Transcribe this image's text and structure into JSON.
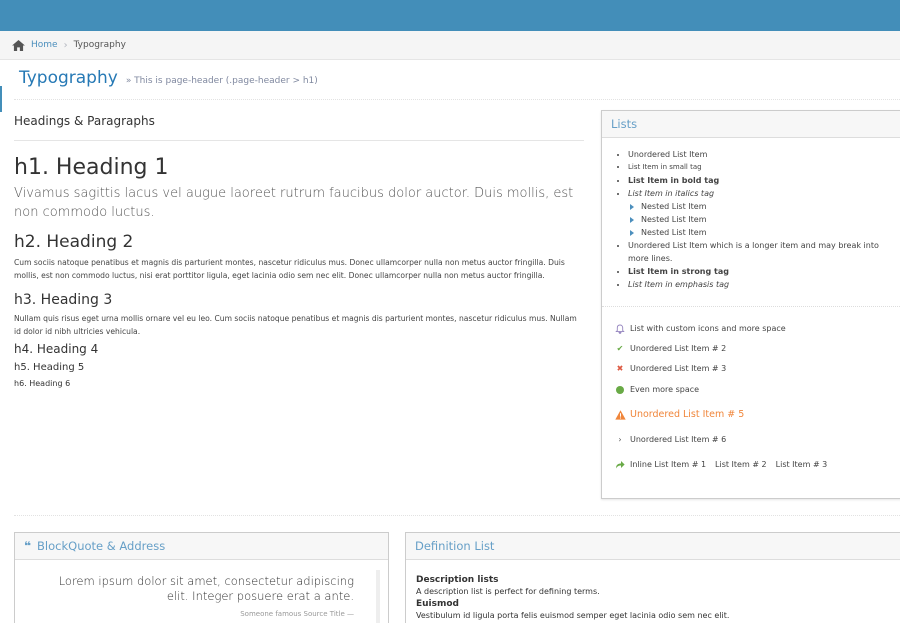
{
  "breadcrumb": {
    "home": "Home",
    "current": "Typography"
  },
  "page_header": {
    "title": "Typography",
    "subtitle": "» This is page-header (.page-header > h1)"
  },
  "headings": {
    "section_title": "Headings & Paragraphs",
    "h1": "h1. Heading 1",
    "lead": "Vivamus sagittis lacus vel augue laoreet rutrum faucibus dolor auctor. Duis mollis, est non commodo luctus.",
    "h2": "h2. Heading 2",
    "p2": "Cum sociis natoque penatibus et magnis dis parturient montes, nascetur ridiculus mus. Donec ullamcorper nulla non metus auctor fringilla. Duis mollis, est non commodo luctus, nisi erat porttitor ligula, eget lacinia odio sem nec elit. Donec ullamcorper nulla non metus auctor fringilla.",
    "h3": "h3. Heading 3",
    "p3": "Nullam quis risus eget urna mollis ornare vel eu leo. Cum sociis natoque penatibus et magnis dis parturient montes, nascetur ridiculus mus. Nullam id dolor id nibh ultricies vehicula.",
    "h4": "h4. Heading 4",
    "h5": "h5. Heading 5",
    "h6": "h6. Heading 6"
  },
  "lists": {
    "title": "Lists",
    "items": [
      "Unordered List Item",
      "List Item in small tag",
      "List Item in bold tag",
      "List Item in italics tag"
    ],
    "nested": [
      "Nested List Item",
      "Nested List Item",
      "Nested List Item"
    ],
    "items_after": [
      "Unordered List Item which is a longer item and may break into more lines.",
      "List Item in strong tag",
      "List Item in emphasis tag"
    ],
    "icon_items": [
      "List with custom icons and more space",
      "Unordered List Item # 2",
      "Unordered List Item # 3",
      "Even more space",
      "Unordered List Item # 5",
      "Unordered List Item # 6"
    ],
    "inline_items": [
      "Inline List Item # 1",
      "List Item # 2",
      "List Item # 3"
    ],
    "icon_colors": {
      "bell": "#9585bf",
      "check": "#69aa46",
      "times": "#dd5a43",
      "circle": "#69aa46",
      "warning": "#f0863b",
      "angle": "#555555",
      "share": "#69aa46"
    }
  },
  "blockquote": {
    "title": "BlockQuote & Address",
    "text": "Lorem ipsum dolor sit amet, consectetur adipiscing elit. Integer posuere erat a ante.",
    "source": "Someone famous Source Title —"
  },
  "deflist": {
    "title": "Definition List",
    "dt1": "Description lists",
    "dd1": "A description list is perfect for defining terms.",
    "dt2": "Euismod",
    "dd2": "Vestibulum id ligula porta felis euismod semper eget lacinia odio sem nec elit."
  },
  "colors": {
    "topbar": "#438eb9",
    "link": "#4c8fbd",
    "header_title": "#2679b5",
    "box_title": "#669fc7"
  }
}
